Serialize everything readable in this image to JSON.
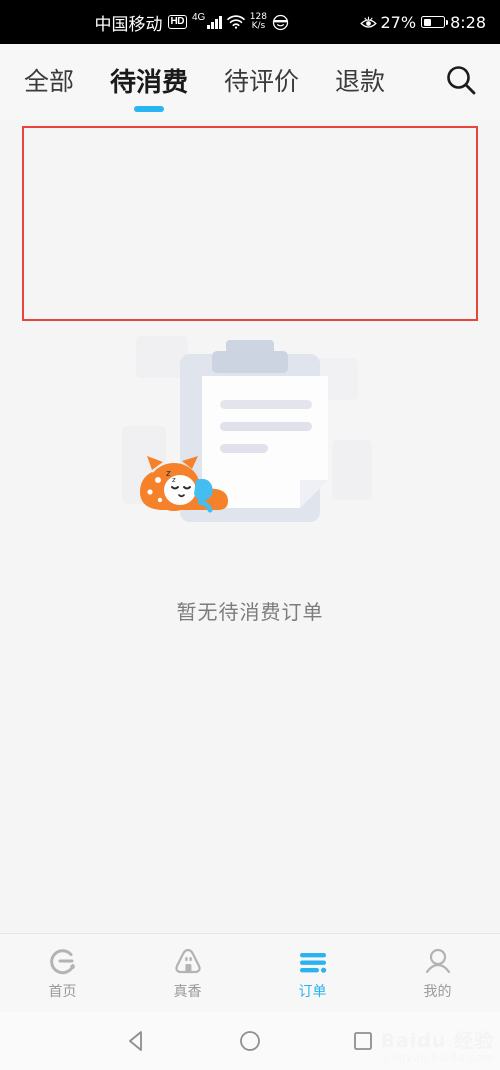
{
  "status_bar": {
    "carrier": "中国移动",
    "hd_badge": "HD",
    "network_type": "4G",
    "signal_icon": "signal-bars-icon",
    "wifi_icon": "wifi-icon",
    "net_speed_value": "128",
    "net_speed_unit": "K/s",
    "emoji_icon": "sunglasses-face-icon",
    "eye_comfort_icon": "eye-icon",
    "battery_percent": "27%",
    "battery_icon": "battery-icon",
    "time": "8:28"
  },
  "tabs": {
    "items": [
      {
        "label": "全部",
        "active": false
      },
      {
        "label": "待消费",
        "active": true
      },
      {
        "label": "待评价",
        "active": false
      },
      {
        "label": "退款",
        "active": false
      }
    ],
    "search_icon": "search-icon",
    "active_underline_color": "#29b6f0"
  },
  "annotation": {
    "box_color": "#e8453c",
    "label": ""
  },
  "empty_state": {
    "illustration_icon": "empty-order-clipboard-mascot-illustration",
    "message": "暂无待消费订单",
    "clipboard_color": "#dfe4ed",
    "mascot_color": "#f5822a"
  },
  "bottom_nav": {
    "items": [
      {
        "label": "首页",
        "icon": "ele-logo-icon",
        "active": false
      },
      {
        "label": "真香",
        "icon": "riceball-icon",
        "active": false
      },
      {
        "label": "订单",
        "icon": "order-list-icon",
        "active": true
      },
      {
        "label": "我的",
        "icon": "person-icon",
        "active": false
      }
    ],
    "active_color": "#2ab3ef",
    "inactive_color": "#9a9a9a"
  },
  "android_nav": {
    "back_icon": "back-triangle-icon",
    "home_icon": "home-circle-icon",
    "recents_icon": "recents-square-icon"
  },
  "watermark": {
    "main": "Baidu 经验",
    "sub": "jingyan.baidu.com"
  }
}
